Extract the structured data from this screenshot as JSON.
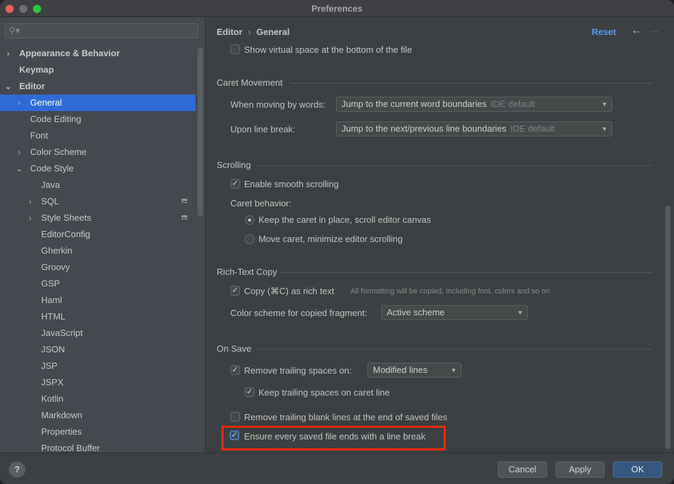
{
  "window": {
    "title": "Preferences"
  },
  "sidebar": {
    "search": {
      "placeholder": "",
      "value": ""
    },
    "items": [
      {
        "label": "Appearance & Behavior",
        "arrow": "›",
        "expanded": false,
        "level": 0,
        "bold": true
      },
      {
        "label": "Keymap",
        "arrow": "",
        "level": 0,
        "bold": true
      },
      {
        "label": "Editor",
        "arrow": "⌄",
        "expanded": true,
        "level": 0,
        "bold": true
      },
      {
        "label": "General",
        "arrow": "›",
        "level": 1,
        "selected": true
      },
      {
        "label": "Code Editing",
        "arrow": "",
        "level": 1
      },
      {
        "label": "Font",
        "arrow": "",
        "level": 1
      },
      {
        "label": "Color Scheme",
        "arrow": "›",
        "level": 1
      },
      {
        "label": "Code Style",
        "arrow": "⌄",
        "expanded": true,
        "level": 1
      },
      {
        "label": "Java",
        "arrow": "",
        "level": 2
      },
      {
        "label": "SQL",
        "arrow": "›",
        "level": 2,
        "badge": true
      },
      {
        "label": "Style Sheets",
        "arrow": "›",
        "level": 2,
        "badge": true
      },
      {
        "label": "EditorConfig",
        "arrow": "",
        "level": 2
      },
      {
        "label": "Gherkin",
        "arrow": "",
        "level": 2
      },
      {
        "label": "Groovy",
        "arrow": "",
        "level": 2
      },
      {
        "label": "GSP",
        "arrow": "",
        "level": 2
      },
      {
        "label": "Haml",
        "arrow": "",
        "level": 2
      },
      {
        "label": "HTML",
        "arrow": "",
        "level": 2
      },
      {
        "label": "JavaScript",
        "arrow": "",
        "level": 2
      },
      {
        "label": "JSON",
        "arrow": "",
        "level": 2
      },
      {
        "label": "JSP",
        "arrow": "",
        "level": 2
      },
      {
        "label": "JSPX",
        "arrow": "",
        "level": 2
      },
      {
        "label": "Kotlin",
        "arrow": "",
        "level": 2
      },
      {
        "label": "Markdown",
        "arrow": "",
        "level": 2
      },
      {
        "label": "Properties",
        "arrow": "",
        "level": 2
      },
      {
        "label": "Protocol Buffer",
        "arrow": "",
        "level": 2
      }
    ]
  },
  "header": {
    "breadcrumb": [
      "Editor",
      "General"
    ],
    "breadcrumb_sep": "›",
    "reset_label": "Reset",
    "back_icon": "←",
    "forward_icon": "→"
  },
  "content": {
    "show_virtual_space": {
      "label": "Show virtual space at the bottom of the file",
      "checked": false
    },
    "caret_movement": {
      "title": "Caret Movement",
      "moving_by_words": {
        "label": "When moving by words:",
        "value": "Jump to the current word boundaries",
        "note": "IDE default"
      },
      "line_break": {
        "label": "Upon line break:",
        "value": "Jump to the next/previous line boundaries",
        "note": "IDE default"
      }
    },
    "scrolling": {
      "title": "Scrolling",
      "smooth": {
        "label": "Enable smooth scrolling",
        "checked": true
      },
      "caret_behavior_label": "Caret behavior:",
      "options": [
        {
          "label": "Keep the caret in place, scroll editor canvas",
          "selected": true
        },
        {
          "label": "Move caret, minimize editor scrolling",
          "selected": false
        }
      ]
    },
    "rich_text": {
      "title": "Rich-Text Copy",
      "copy": {
        "label": "Copy (⌘C) as rich text",
        "checked": true,
        "hint": "All formatting will be copied, including font, colors and so on"
      },
      "scheme": {
        "label": "Color scheme for copied fragment:",
        "value": "Active scheme"
      }
    },
    "on_save": {
      "title": "On Save",
      "remove_trailing": {
        "label": "Remove trailing spaces on:",
        "checked": true,
        "value": "Modified lines"
      },
      "keep_trailing": {
        "label": "Keep trailing spaces on caret line",
        "checked": true
      },
      "remove_blank": {
        "label": "Remove trailing blank lines at the end of saved files",
        "checked": false
      },
      "ensure_line_break": {
        "label": "Ensure every saved file ends with a line break",
        "checked": true,
        "highlighted": true
      }
    }
  },
  "footer": {
    "help_label": "?",
    "cancel_label": "Cancel",
    "apply_label": "Apply",
    "ok_label": "OK"
  },
  "colors": {
    "accent": "#2f6bd6",
    "link": "#589df6",
    "highlight_box": "#ff2a0b",
    "primary_button": "#365880"
  }
}
